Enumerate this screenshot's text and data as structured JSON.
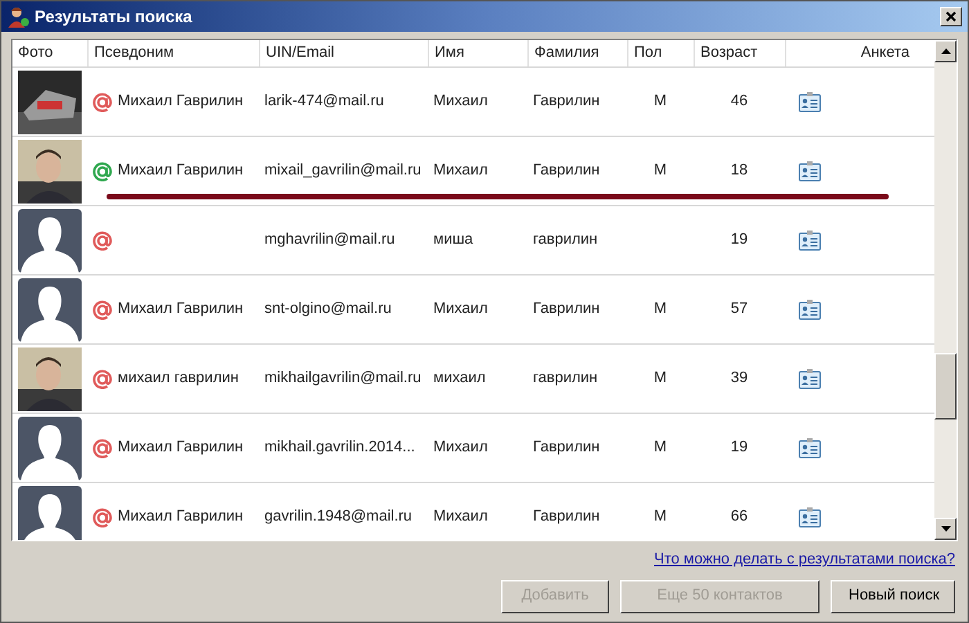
{
  "window": {
    "title": "Результаты поиска"
  },
  "table": {
    "columns": [
      "Фото",
      "Псевдоним",
      "UIN/Email",
      "Имя",
      "Фамилия",
      "Пол",
      "Возраст",
      "Анкета"
    ],
    "rows": [
      {
        "kind": "picture",
        "color": "#e05a5a",
        "nickname": "Михаил Гаврилин",
        "email": "larik-474@mail.ru",
        "first_name": "Михаил",
        "last_name": "Гаврилин",
        "sex": "М",
        "age": "46",
        "underlined": false
      },
      {
        "kind": "picture",
        "color": "#2fa84f",
        "nickname": "Михаил Гаврилин",
        "email": "mixail_gavrilin@mail.ru",
        "first_name": "Михаил",
        "last_name": "Гаврилин",
        "sex": "М",
        "age": "18",
        "underlined": true
      },
      {
        "kind": "silhouette",
        "color": "#e05a5a",
        "email": "mghavrilin@mail.ru",
        "first_name": "миша",
        "last_name": "гаврилин",
        "age": "19",
        "underlined": false
      },
      {
        "kind": "silhouette",
        "color": "#e05a5a",
        "nickname": "Михаил Гаврилин",
        "email": "snt-olgino@mail.ru",
        "first_name": "Михаил",
        "last_name": "Гаврилин",
        "sex": "М",
        "age": "57",
        "underlined": false
      },
      {
        "kind": "picture",
        "color": "#e05a5a",
        "nickname": "михаил гаврилин",
        "email": "mikhailgavrilin@mail.ru",
        "first_name": "михаил",
        "last_name": "гаврилин",
        "sex": "М",
        "age": "39",
        "underlined": false
      },
      {
        "kind": "silhouette",
        "color": "#e05a5a",
        "nickname": "Михаил Гаврилин",
        "email": "mikhail.gavrilin.2014...",
        "first_name": "Михаил",
        "last_name": "Гаврилин",
        "sex": "М",
        "age": "19",
        "underlined": false
      },
      {
        "kind": "silhouette",
        "color": "#e05a5a",
        "nickname": "Михаил Гаврилин",
        "email": "gavrilin.1948@mail.ru",
        "first_name": "Михаил",
        "last_name": "Гаврилин",
        "sex": "М",
        "age": "66",
        "underlined": false
      }
    ]
  },
  "help_link": "Что можно делать с результатами поиска?",
  "buttons": [
    {
      "label": "Добавить",
      "disabled": true
    },
    {
      "label": "Еще 50 контактов",
      "disabled": true
    },
    {
      "label": "Новый поиск",
      "disabled": false
    }
  ]
}
